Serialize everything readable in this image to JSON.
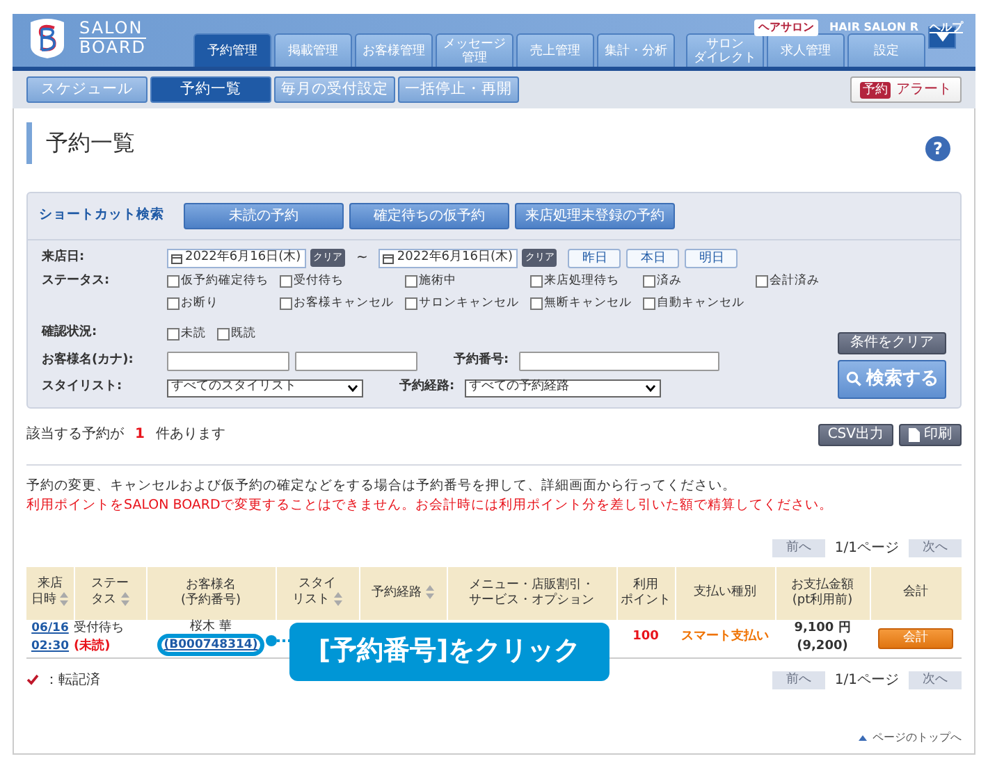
{
  "logo": {
    "line1": "SALON",
    "line2": "BOARD"
  },
  "account": {
    "badge": "ヘアサロン",
    "name": "HAIR SALON R",
    "help": "ヘルプ"
  },
  "main_tabs": [
    {
      "label": "予約管理",
      "selected": true
    },
    {
      "label": "掲載管理",
      "selected": false
    },
    {
      "label": "お客様管理",
      "selected": false
    },
    {
      "label": [
        "メッセージ",
        "管理"
      ],
      "selected": false
    },
    {
      "label": "売上管理",
      "selected": false
    },
    {
      "label": "集計・分析",
      "selected": false
    },
    {
      "label": [
        "サロン",
        "ダイレクト"
      ],
      "selected": false
    },
    {
      "label": "求人管理",
      "selected": false
    },
    {
      "label": "設定",
      "selected": false
    }
  ],
  "sub_tabs": [
    {
      "label": "スケジュール",
      "selected": false
    },
    {
      "label": "予約一覧",
      "selected": true
    },
    {
      "label": "毎月の受付設定",
      "selected": false
    },
    {
      "label": "一括停止・再開",
      "selected": false
    }
  ],
  "alert": {
    "badge": "予約",
    "label": "アラート"
  },
  "page_title": "予約一覧",
  "help_mark": "?",
  "shortcut": {
    "label": "ショートカット検索",
    "buttons": [
      "未読の予約",
      "確定待ちの仮予約",
      "来店処理未登録の予約"
    ]
  },
  "visit_date": {
    "label": "来店日:",
    "from": "2022年6月16日(木)",
    "from_clear": "クリア",
    "separator": "~",
    "to": "2022年6月16日(木)",
    "to_clear": "クリア",
    "quick": [
      "昨日",
      "本日",
      "明日"
    ]
  },
  "status": {
    "label": "ステータス:",
    "rows": [
      [
        {
          "label": "仮予約確定待ち",
          "checked": false
        },
        {
          "label": "受付待ち",
          "checked": false
        },
        {
          "label": "施術中",
          "checked": false
        },
        {
          "label": "来店処理待ち",
          "checked": false
        },
        {
          "label": "済み",
          "checked": false
        },
        {
          "label": "会計済み",
          "checked": false
        }
      ],
      [
        {
          "label": "お断り",
          "checked": false
        },
        {
          "label": "お客様キャンセル",
          "checked": false
        },
        {
          "label": "サロンキャンセル",
          "checked": false
        },
        {
          "label": "無断キャンセル",
          "checked": false
        },
        {
          "label": "自動キャンセル",
          "checked": false
        }
      ]
    ]
  },
  "confirmation": {
    "label": "確認状況:",
    "options": [
      {
        "label": "未読",
        "checked": false
      },
      {
        "label": "既読",
        "checked": false
      }
    ]
  },
  "customer_name": {
    "label": "お客様名(カナ):"
  },
  "reservation_number": {
    "label": "予約番号:"
  },
  "stylist": {
    "label": "スタイリスト:",
    "value": "すべてのスタイリスト"
  },
  "route": {
    "label": "予約経路:",
    "value": "すべての予約経路"
  },
  "clear_button": "条件をクリア",
  "search_button": "検索する",
  "results": {
    "prefix": "該当する予約が",
    "count": "1",
    "suffix": "件あります",
    "csv": "CSV出力",
    "print": "印刷"
  },
  "notes": [
    {
      "kind": "normal",
      "text": "予約の変更、キャンセルおよび仮予約の確定などをする場合は予約番号を押して、詳細画面から行ってください。"
    },
    {
      "kind": "warning",
      "text": "利用ポイントをSALON BOARDで変更することはできません。お会計時には利用ポイント分を差し引いた額で精算してください。"
    }
  ],
  "pagination_top": {
    "prev": "前へ",
    "page": "1/1ページ",
    "next": "次へ"
  },
  "table": {
    "columns": [
      {
        "label": [
          "来店",
          "日時"
        ],
        "sortable": true
      },
      {
        "label": [
          "ステー",
          "タス"
        ],
        "sortable": true
      },
      {
        "label": [
          "お客様名",
          "(予約番号)"
        ],
        "sortable": false
      },
      {
        "label": [
          "スタイ",
          "リスト"
        ],
        "sortable": true
      },
      {
        "label": [
          "予約経路"
        ],
        "sortable": true
      },
      {
        "label": [
          "メニュー・店販割引・",
          "サービス・オプション"
        ],
        "sortable": false
      },
      {
        "label": [
          "利用",
          "ポイント"
        ],
        "sortable": false
      },
      {
        "label": [
          "支払い種別"
        ],
        "sortable": false
      },
      {
        "label": [
          "お支払金額",
          "(pt利用前)"
        ],
        "sortable": false
      },
      {
        "label": [
          "会計"
        ],
        "sortable": false
      }
    ],
    "rows": [
      {
        "date": "06/16",
        "time": "02:30",
        "status": "受付待ち",
        "read_state": "(未読)",
        "customer": "桜木 華",
        "number": "(B000748314)",
        "points": "100",
        "payment_type": "スマート支払い",
        "amount": "9,100 円",
        "amount_before": "(9,200)",
        "action": "会計"
      }
    ]
  },
  "callout": {
    "text": "[予約番号]をクリック"
  },
  "legend": {
    "text": "：転記済"
  },
  "pagination_bottom": {
    "prev": "前へ",
    "page": "1/1ページ",
    "next": "次へ"
  },
  "page_top": "ページのトップへ"
}
